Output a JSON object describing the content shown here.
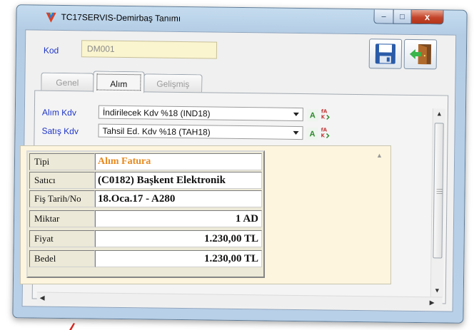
{
  "window": {
    "title": "TC17SERVIS-Demirbaş Tanımı",
    "controls": {
      "minimize": "–",
      "maximize": "□",
      "close": "x"
    }
  },
  "header": {
    "kod_label": "Kod",
    "kod_value": "DM001"
  },
  "tabs": [
    {
      "label": "Genel",
      "active": false
    },
    {
      "label": "Alım",
      "active": true
    },
    {
      "label": "Gelişmiş",
      "active": false
    }
  ],
  "alim_tab": {
    "alim_kdv": {
      "label": "Alım Kdv",
      "value": "İndirilecek Kdv %18 (IND18)"
    },
    "satis_kdv": {
      "label": "Satış Kdv",
      "value": "Tahsil Ed. Kdv %18 (TAH18)"
    },
    "a_button": "A"
  },
  "properties": [
    {
      "key": "Tipi",
      "value": "Alım Fatura"
    },
    {
      "key": "Satıcı",
      "value": "(C0182) Başkent Elektronik"
    },
    {
      "key": "Fiş Tarih/No",
      "value": "18.Oca.17 - A280"
    },
    {
      "key": "Miktar",
      "value": "1 AD"
    },
    {
      "key": "Fiyat",
      "value": "1.230,00 TL"
    },
    {
      "key": "Bedel",
      "value": "1.230,00 TL"
    }
  ],
  "colors": {
    "label_blue": "#1d34c8",
    "type_orange": "#e8891d",
    "input_yellow": "#fbf5cf"
  },
  "icons": {
    "app": "app-logo-icon",
    "save": "floppy-disk-icon",
    "exit": "exit-door-icon",
    "font": "font-a-icon",
    "case": "text-case-icon"
  }
}
